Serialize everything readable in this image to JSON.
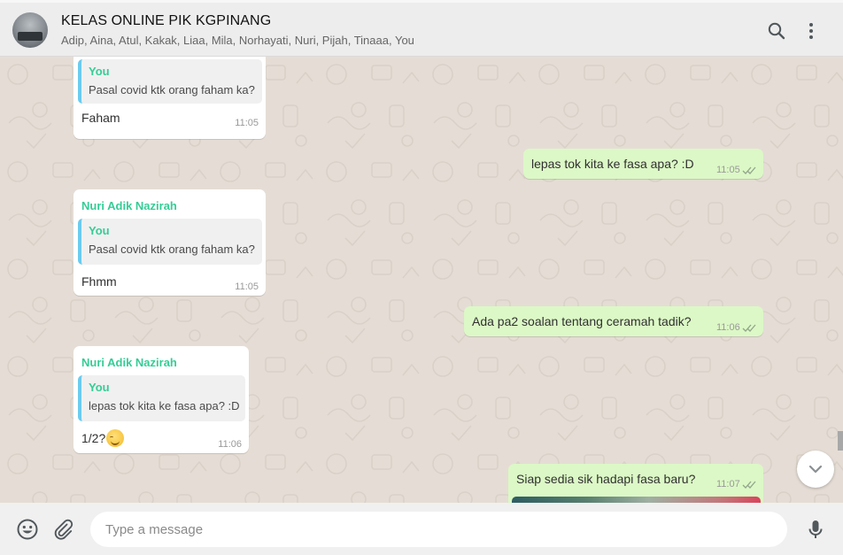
{
  "header": {
    "title": "KELAS ONLINE PIK KGPINANG",
    "participants": "Adip, Aina, Atul, Kakak, Liaa, Mila, Norhayati, Nuri, Pijah, Tinaaa, You"
  },
  "messages": [
    {
      "sender": "",
      "quote_name": "You",
      "quote_text": "Pasal covid ktk orang faham ka?",
      "text": "Faham",
      "time": "11:05"
    },
    {
      "text": "lepas tok kita ke fasa apa? :D",
      "time": "11:05",
      "status": "read"
    },
    {
      "sender": "Nuri Adik Nazirah",
      "quote_name": "You",
      "quote_text": "Pasal covid ktk orang faham ka?",
      "text": "Fhmm",
      "time": "11:05"
    },
    {
      "text": "Ada pa2 soalan tentang ceramah tadik?",
      "time": "11:06",
      "status": "read"
    },
    {
      "sender": "Nuri Adik Nazirah",
      "quote_name": "You",
      "quote_text": "lepas tok kita ke fasa apa? :D",
      "text": "1/2?",
      "emoji": "relieved-face",
      "time": "11:06"
    },
    {
      "text": "Siap sedia sik hadapi fasa baru?",
      "time": "11:07",
      "status": "read"
    }
  ],
  "composer": {
    "placeholder": "Type a message"
  },
  "colors": {
    "incoming": "#ffffff",
    "outgoing": "#dcf8c6",
    "sender_name": "#35cd96",
    "quote_bar": "#6bcbef",
    "read_ticks": "#4fc3f7",
    "wallpaper": "#e5ddd5"
  },
  "icons": {
    "search": "search-icon",
    "menu": "menu-dots-icon",
    "scroll_down": "chevron-down-icon",
    "emoji": "emoji-icon",
    "attach": "paperclip-icon",
    "mic": "microphone-icon"
  }
}
